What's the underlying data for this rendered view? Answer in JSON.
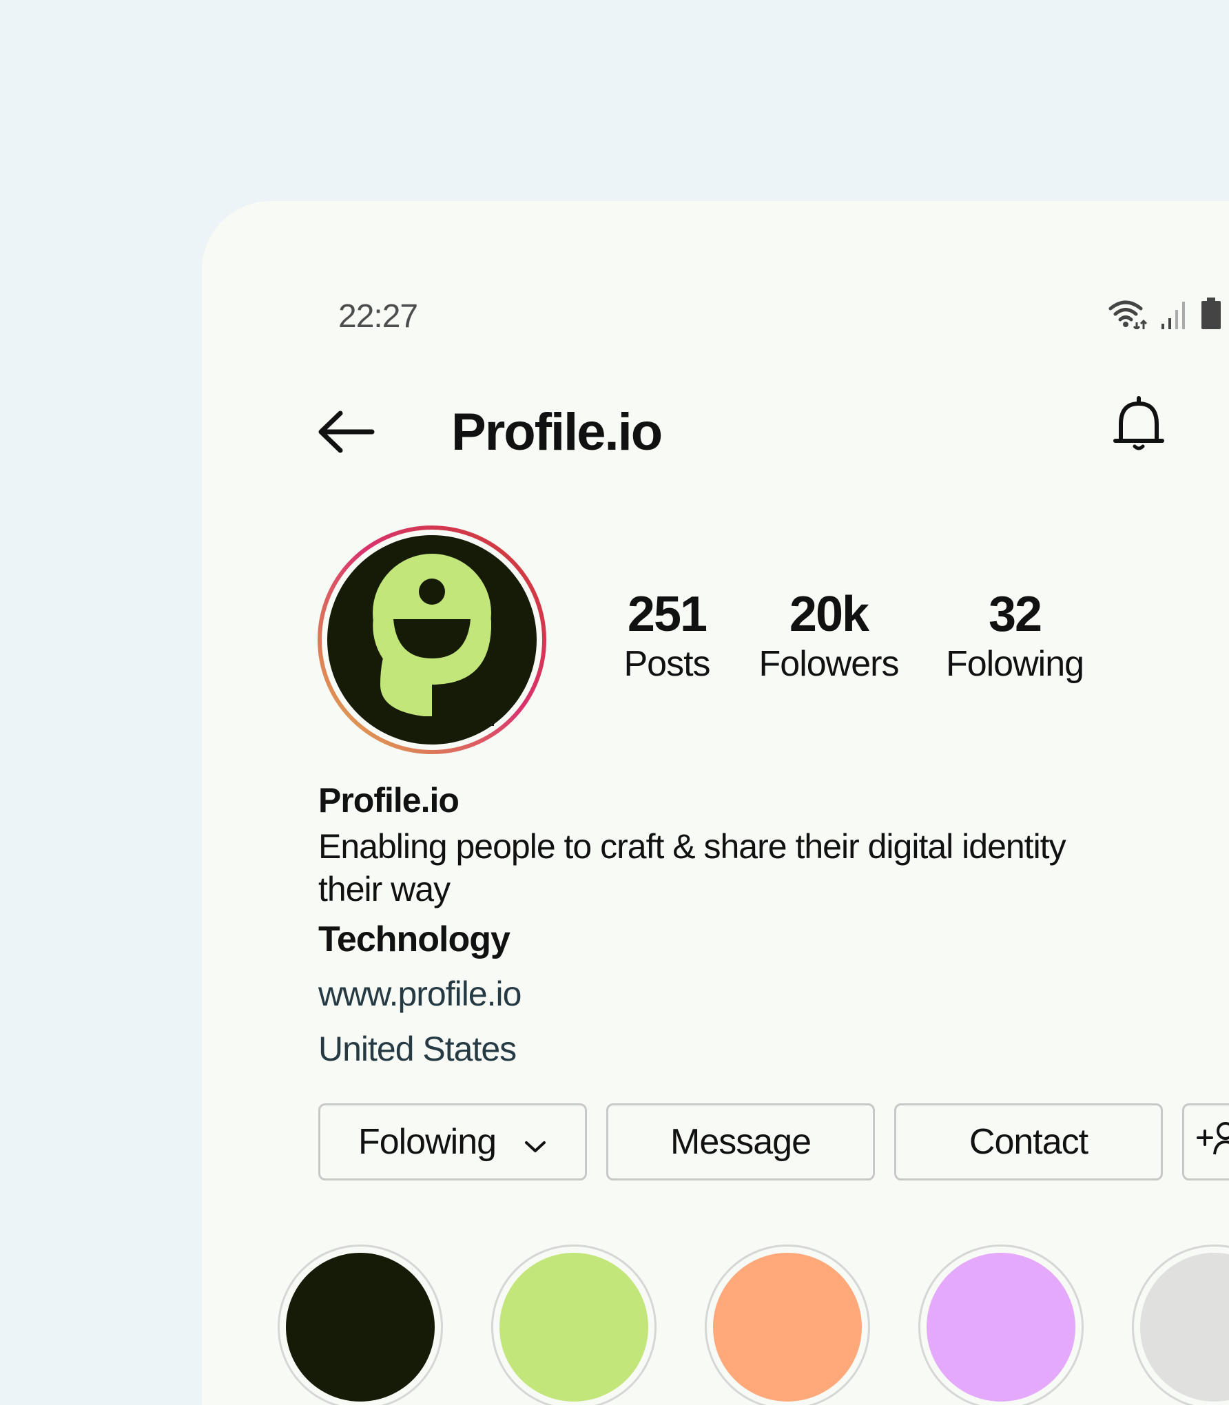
{
  "status_bar": {
    "time": "22:27",
    "icons": [
      "wifi-icon",
      "signal-icon",
      "battery-icon"
    ]
  },
  "header": {
    "back_icon": "back-arrow-icon",
    "title": "Profile.io",
    "bell_icon": "bell-icon"
  },
  "avatar": {
    "ring_colors": [
      "#e0b44a",
      "#d9326e",
      "#cc3e2d"
    ],
    "background": "#161b07",
    "logo_color": "#c2e67a"
  },
  "stats": [
    {
      "value": "251",
      "label": "Posts"
    },
    {
      "value": "20k",
      "label": "Folowers"
    },
    {
      "value": "32",
      "label": "Folowing"
    }
  ],
  "bio": {
    "name": "Profile.io",
    "description": "Enabling people to craft & share their digital identity their way",
    "category": "Technology",
    "link": "www.profile.io",
    "location": "United States"
  },
  "actions": {
    "following_label": "Folowing",
    "message_label": "Message",
    "contact_label": "Contact",
    "add_person_icon": "add-person-icon"
  },
  "highlights": [
    {
      "color": "#161b07"
    },
    {
      "color": "#c2e67a"
    },
    {
      "color": "#ffa87a"
    },
    {
      "color": "#e5a9fb"
    },
    {
      "color": "#e0e0de"
    }
  ]
}
